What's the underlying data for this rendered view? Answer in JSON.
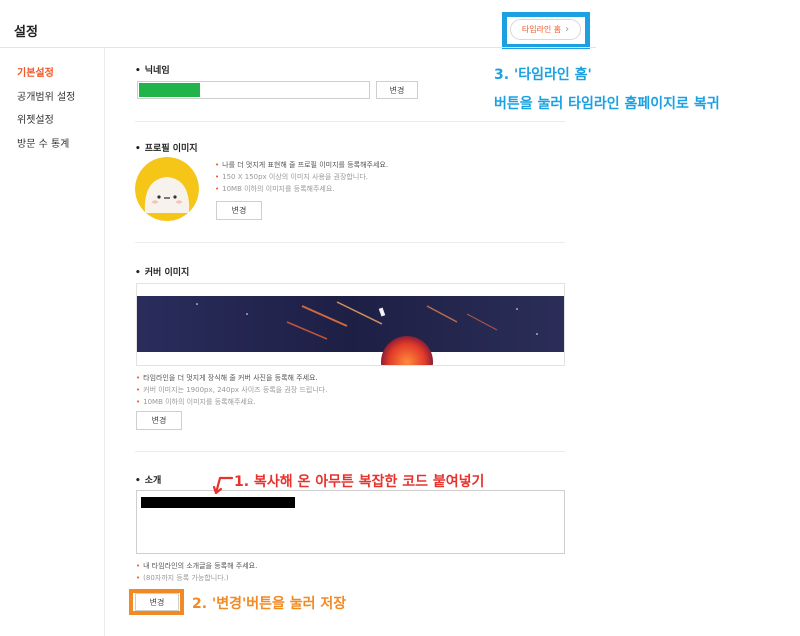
{
  "header": {
    "title": "설정",
    "timeline_home_button": "타임라인 홈",
    "chevron": "›"
  },
  "sidebar": {
    "items": [
      {
        "label": "기본설정",
        "active": true
      },
      {
        "label": "공개범위 설정",
        "active": false
      },
      {
        "label": "위젯설정",
        "active": false
      },
      {
        "label": "방문 수 통계",
        "active": false
      }
    ]
  },
  "nickname": {
    "title": "닉네임",
    "value": "",
    "change_button": "변경"
  },
  "profile_image": {
    "title": "프로필 이미지",
    "info": [
      "나를 더 멋지게 표현해 줄 프로필 이미지를 등록해주세요.",
      "150 X 150px 이상의 이미지 사용을 권장합니다.",
      "10MB 이하의 이미지를 등록해주세요."
    ],
    "change_button": "변경"
  },
  "cover_image": {
    "title": "커버 이미지",
    "info": [
      "타임라인을 더 멋지게 장식해 줄 커버 사진을 등록해 주세요.",
      "커버 이미지는 1900px, 240px 사이즈 등록을 권장 드립니다.",
      "10MB 이하의 이미지를 등록해주세요."
    ],
    "change_button": "변경"
  },
  "intro": {
    "title": "소개",
    "info": [
      "내 타임라인의 소개글을 등록해 주세요.",
      "(80자까지 등록 가능합니다.)"
    ],
    "change_button": "변경"
  },
  "annotations": {
    "step3_line1": "3. '타임라인 홈'",
    "step3_line2": "버튼을 눌러 타임라인 홈페이지로 복귀",
    "step1": "1. 복사해 온 아무튼 복잡한 코드 붙여넣기",
    "step2": "2. '변경'버튼을 눌러 저장"
  },
  "colors": {
    "accent": "#f1592a",
    "highlight_blue": "#1ba1e2",
    "highlight_red": "#e8322e",
    "highlight_orange": "#f28a24",
    "nickname_fill": "#21b44b",
    "avatar_yellow": "#f5c518",
    "cover_sky": "#20224a"
  },
  "icons": [
    "chevron-right-icon",
    "arrow-annotation-icon",
    "avatar-character-icon"
  ]
}
